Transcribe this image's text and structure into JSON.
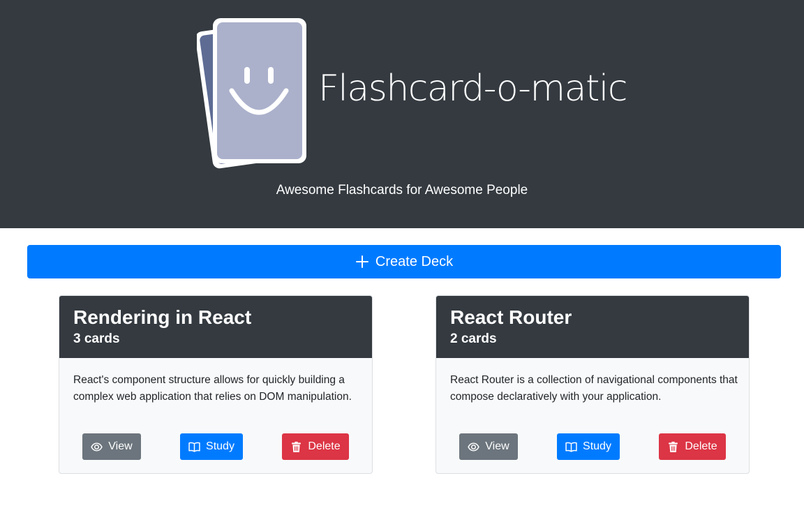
{
  "header": {
    "title": "Flashcard-o-matic",
    "tagline": "Awesome Flashcards for Awesome People",
    "background": "#343a40"
  },
  "create_deck": {
    "label": "Create Deck",
    "icon": "plus-icon",
    "color": "#007bff"
  },
  "decks": [
    {
      "name": "Rendering in React",
      "count": "3 cards",
      "description": "React's component structure allows for quickly building a complex web application that relies on DOM manipulation.",
      "view_label": "View",
      "study_label": "Study",
      "delete_label": "Delete"
    },
    {
      "name": "React Router",
      "count": "2 cards",
      "description": "React Router is a collection of navigational components that compose declaratively with your application.",
      "view_label": "View",
      "study_label": "Study",
      "delete_label": "Delete"
    }
  ],
  "colors": {
    "view": "#6c757d",
    "study": "#007bff",
    "delete": "#dc3545"
  },
  "icons": {
    "view": "eye-icon",
    "study": "book-icon",
    "delete": "trash-icon",
    "logo": "smiley-card-logo"
  }
}
